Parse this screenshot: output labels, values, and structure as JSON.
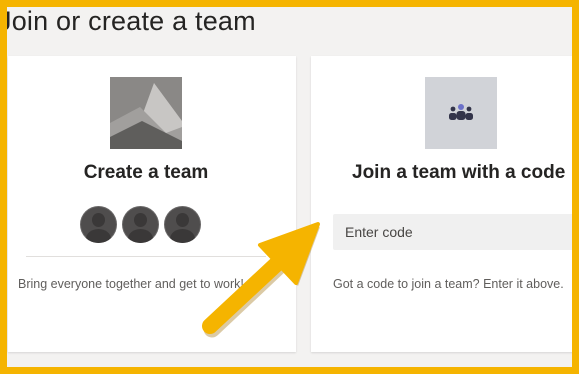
{
  "page": {
    "title": "Join or create a team"
  },
  "create_card": {
    "title": "Create a team",
    "description": "Bring everyone together and get to work!",
    "avatars": [
      "person-icon",
      "person-icon",
      "person-icon"
    ]
  },
  "join_card": {
    "title": "Join a team with a code",
    "input_placeholder": "Enter code",
    "description": "Got a code to join a team? Enter it above."
  },
  "annotation": {
    "frame_color": "#f5b400",
    "arrow_color": "#f5b400"
  }
}
